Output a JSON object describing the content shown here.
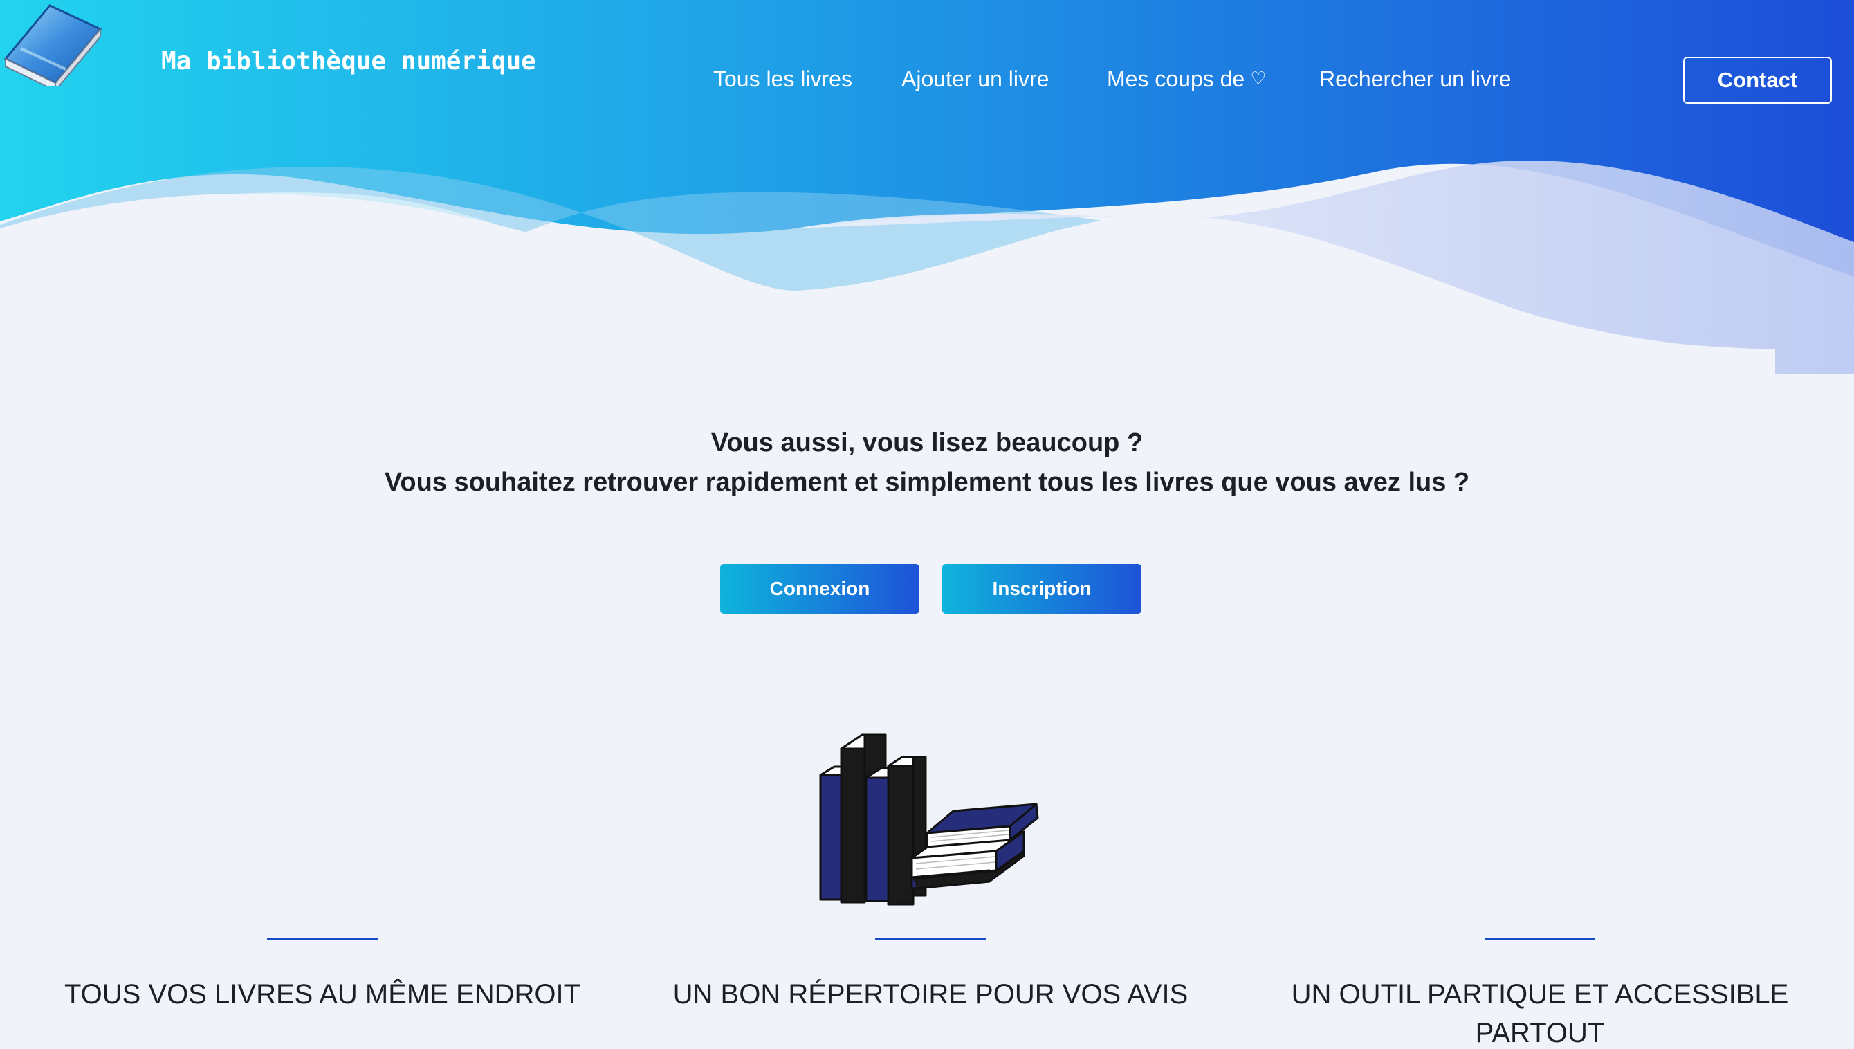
{
  "header": {
    "brand_title": "Ma bibliothèque numérique",
    "logo": "book-logo",
    "nav": [
      {
        "label": "Tous les livres"
      },
      {
        "label": "Ajouter un livre"
      },
      {
        "label": "Mes coups de",
        "icon": "heart-icon"
      },
      {
        "label": "Rechercher un livre"
      }
    ],
    "contact_label": "Contact",
    "gradient": {
      "start": "#22d3ee",
      "end": "#1d4ed8"
    }
  },
  "intro": {
    "line1": "Vous aussi, vous lisez beaucoup ?",
    "line2": "Vous souhaitez retrouver rapidement et simplement tous les livres que vous avez lus ?"
  },
  "buttons": {
    "login_label": "Connexion",
    "signup_label": "Inscription"
  },
  "illustration": "books-stack",
  "features": [
    {
      "title": "TOUS VOS LIVRES AU MÊME ENDROIT"
    },
    {
      "title": "UN BON RÉPERTOIRE POUR VOS AVIS"
    },
    {
      "title": "UN OUTIL PARTIQUE ET ACCESSIBLE PARTOUT"
    }
  ],
  "colors": {
    "page_bg": "#f0f3f9",
    "accent_bar": "#1a49c9",
    "button_gradient_start": "#0fb4dc",
    "button_gradient_end": "#1e53d8"
  }
}
